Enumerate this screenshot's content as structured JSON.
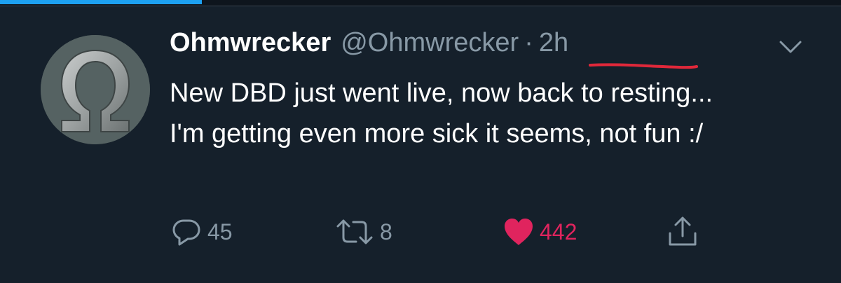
{
  "tweet": {
    "author": {
      "display_name": "Ohmwrecker",
      "handle": "@Ohmwrecker",
      "avatar_icon": "omega-avatar"
    },
    "separator": "·",
    "time": "2h",
    "text": "New DBD just went live, now back to resting... I'm getting even more sick it seems, not fun :/",
    "actions": {
      "reply_count": "45",
      "retweet_count": "8",
      "like_count": "442",
      "liked": true
    }
  },
  "top_progress_fraction": 0.24,
  "colors": {
    "background": "#15202b",
    "text": "#ffffff",
    "muted": "#8899a6",
    "like": "#e0245e",
    "accent": "#1da1f2",
    "annotation": "#e0283a"
  }
}
